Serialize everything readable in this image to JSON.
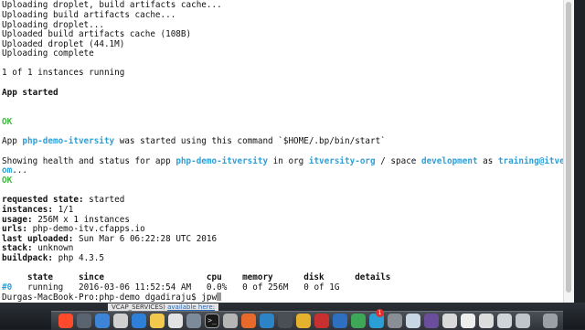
{
  "terminal": {
    "log": {
      "upload_droplet_cache": "Uploading droplet, build artifacts cache...",
      "upload_build_cache": "Uploading build artifacts cache...",
      "upload_droplet": "Uploading droplet...",
      "uploaded_build_cache": "Uploaded build artifacts cache (108B)",
      "uploaded_droplet": "Uploaded droplet (44.1M)",
      "upload_complete": "Uploading complete",
      "instances_running": "1 of 1 instances running",
      "app_started": "App started",
      "ok": "OK"
    },
    "started": {
      "prefix": "App ",
      "app_name": "php-demo-itversity",
      "suffix": " was started using this command `$HOME/.bp/bin/start`"
    },
    "health": {
      "prefix": "Showing health and status for app ",
      "app_name": "php-demo-itversity",
      "in_org": " in org ",
      "org": "itversity-org",
      "space_sep": " / space ",
      "space": "development",
      "as": " as ",
      "user_part1": "training@itversity.c",
      "user_part2": "om",
      "ellipsis": "..."
    },
    "status": {
      "requested_state_label": "requested state:",
      "requested_state_value": " started",
      "instances_label": "instances:",
      "instances_value": " 1/1",
      "usage_label": "usage:",
      "usage_value": " 256M x 1 instances",
      "urls_label": "urls:",
      "urls_value": " php-demo-itv.cfapps.io",
      "last_uploaded_label": "last uploaded:",
      "last_uploaded_value": " Sun Mar 6 06:22:28 UTC 2016",
      "stack_label": "stack:",
      "stack_value": " unknown",
      "buildpack_label": "buildpack:",
      "buildpack_value": " php 4.3.5"
    },
    "instance_table": {
      "header": "     state     since                    cpu    memory      disk      details",
      "row_index": "#0",
      "row_rest": "   running   2016-03-06 11:52:54 AM   0.0%   0 of 256M   0 of 1G"
    },
    "prompt": "Durgas-MacBook-Pro:php-demo dgadiraju$ ",
    "input_value": "jpw"
  },
  "dock": {
    "note_prefix": "VCAP_SERVICES)",
    "note_link": "available here:",
    "badge_count": "1"
  },
  "colors": {
    "ok_green": "#3dbb3d",
    "highlight_cyan": "#2f9fd6",
    "terminal_bg": "#ffffff",
    "dock_bg": "#1e2226"
  }
}
